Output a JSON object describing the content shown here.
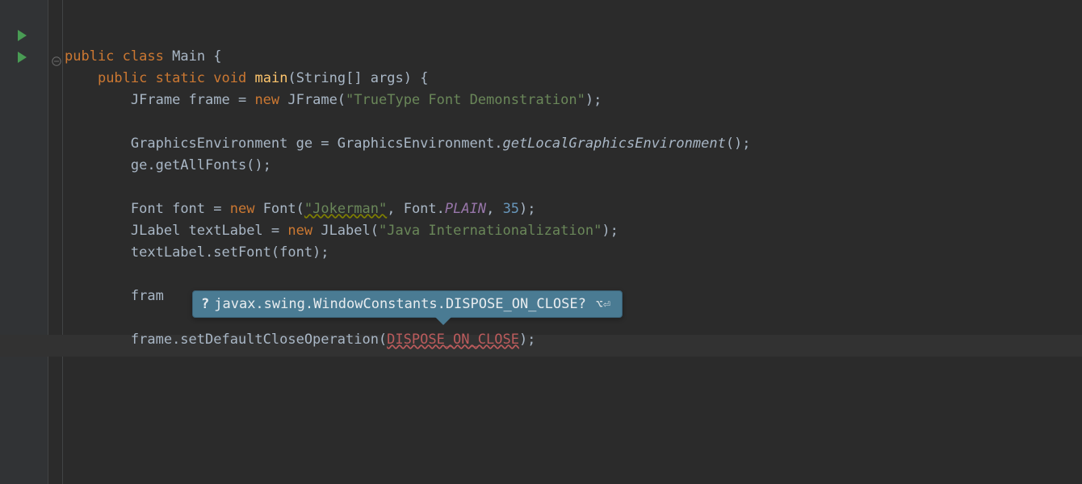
{
  "code": {
    "line1": {
      "kw1": "public",
      "kw2": "class",
      "name": "Main",
      "brace": " {"
    },
    "line2": {
      "kw1": "public",
      "kw2": "static",
      "kw3": "void",
      "mname": "main",
      "params": "(String[] args) {"
    },
    "line3": {
      "type1": "JFrame",
      "var": " frame = ",
      "kw": "new",
      "type2": " JFrame(",
      "str": "\"TrueType Font Demonstration\"",
      "end": ");"
    },
    "line5": {
      "type1": "GraphicsEnvironment",
      "var": " ge = GraphicsEnvironment.",
      "call": "getLocalGraphicsEnvironment",
      "end": "();"
    },
    "line6": "ge.getAllFonts();",
    "line8": {
      "type1": "Font",
      "var": " font = ",
      "kw": "new",
      "type2": " Font(",
      "str": "\"Jokerman\"",
      "mid": ", Font.",
      "const": "PLAIN",
      "mid2": ", ",
      "num": "35",
      "end": ");"
    },
    "line9": {
      "type1": "JLabel",
      "var": " textLabel = ",
      "kw": "new",
      "type2": " JLabel(",
      "str": "\"Java Internationalization\"",
      "end": ");"
    },
    "line10": "textLabel.setFont(font);",
    "line12": "fram",
    "line14": {
      "pre": "frame.setDefaultCloseOperation(",
      "err": "DISPOSE_ON_CLOSE",
      "end": ");"
    }
  },
  "hint": {
    "q": "?",
    "text": "javax.swing.WindowConstants.DISPOSE_ON_CLOSE?",
    "shortcut": "⌥⏎"
  }
}
